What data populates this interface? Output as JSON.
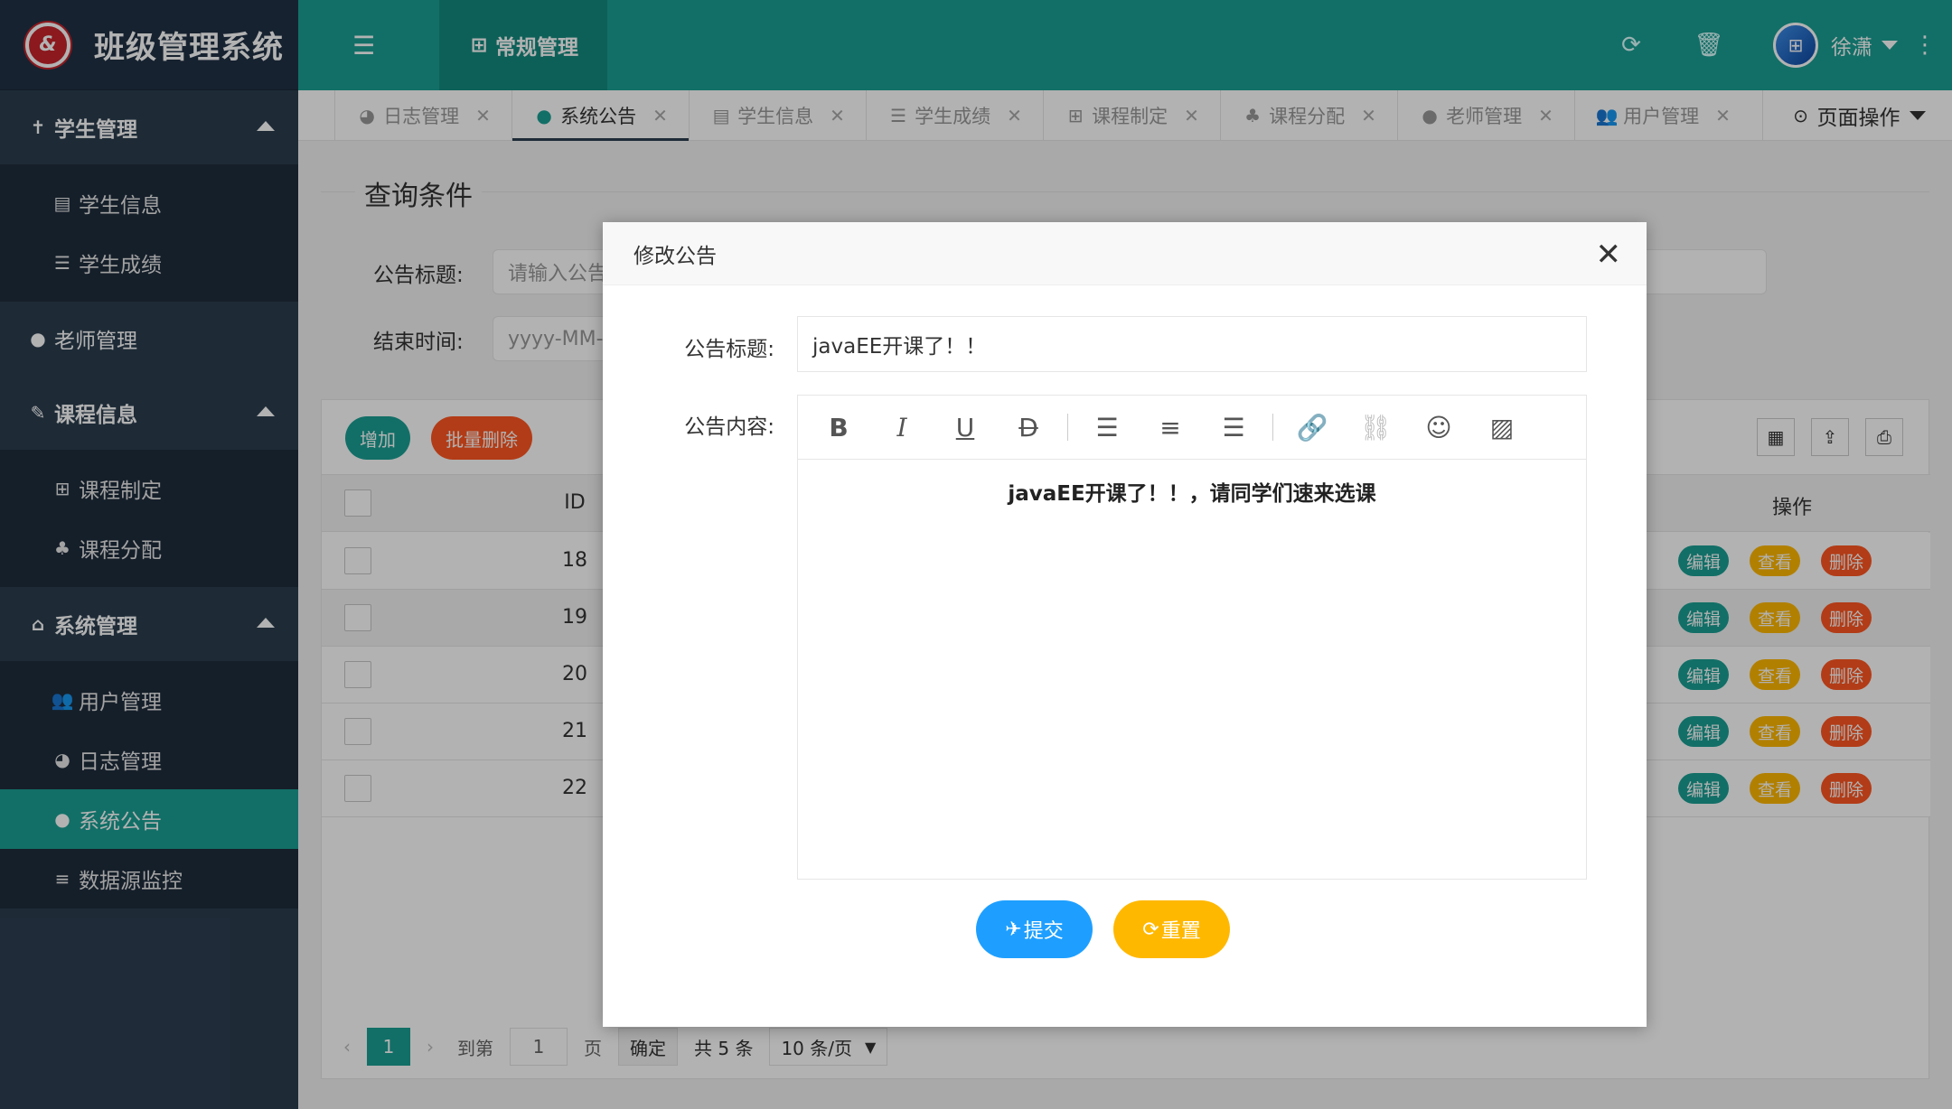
{
  "app": {
    "title": "班级管理系统",
    "logo_text": "&"
  },
  "sidebar": {
    "groups": [
      {
        "label": "学生管理",
        "icon": "person-standing-icon",
        "items": [
          {
            "label": "学生信息",
            "icon": "card-icon"
          },
          {
            "label": "学生成绩",
            "icon": "list-icon"
          }
        ]
      },
      {
        "label": "老师管理",
        "icon": "user-icon"
      },
      {
        "label": "课程信息",
        "icon": "edit-icon",
        "items": [
          {
            "label": "课程制定",
            "icon": "plus-square-icon"
          },
          {
            "label": "课程分配",
            "icon": "sitemap-icon"
          }
        ]
      },
      {
        "label": "系统管理",
        "icon": "home-icon",
        "items": [
          {
            "label": "用户管理",
            "icon": "users-icon"
          },
          {
            "label": "日志管理",
            "icon": "pie-chart-icon"
          },
          {
            "label": "系统公告",
            "icon": "comment-icon",
            "active": true
          },
          {
            "label": "数据源监控",
            "icon": "database-icon"
          }
        ]
      }
    ]
  },
  "topbar": {
    "module_tab": "常规管理",
    "user_name": "徐潇"
  },
  "tabs": [
    {
      "label": "日志管理"
    },
    {
      "label": "系统公告",
      "active": true
    },
    {
      "label": "学生信息"
    },
    {
      "label": "学生成绩"
    },
    {
      "label": "课程制定"
    },
    {
      "label": "课程分配"
    },
    {
      "label": "老师管理"
    },
    {
      "label": "用户管理"
    }
  ],
  "page_op": "页面操作",
  "query": {
    "title": "查询条件",
    "title_label": "公告标题:",
    "title_placeholder": "请输入公告",
    "end_label": "结束时间:",
    "end_placeholder": "yyyy-MM-d"
  },
  "table": {
    "add_label": "增加",
    "batch_delete_label": "批量删除",
    "col_id": "ID",
    "col_action": "操作",
    "rows": [
      {
        "id": "18"
      },
      {
        "id": "19"
      },
      {
        "id": "20"
      },
      {
        "id": "21"
      },
      {
        "id": "22"
      }
    ],
    "edit_label": "编辑",
    "view_label": "查看",
    "delete_label": "删除"
  },
  "pager": {
    "current": "1",
    "goto_label": "到第",
    "goto_value": "1",
    "page_label": "页",
    "confirm_label": "确定",
    "total_label": "共 5 条",
    "per_page": "10 条/页"
  },
  "modal": {
    "title": "修改公告",
    "title_label": "公告标题:",
    "title_value": "javaEE开课了！！",
    "content_label": "公告内容:",
    "content_value": "javaEE开课了！！，请同学们速来选课",
    "submit_label": "提交",
    "reset_label": "重置"
  },
  "colors": {
    "primary": "#1aa094",
    "sidebar": "#2c3e50",
    "warn": "#ffb800",
    "danger": "#ff5722",
    "blue": "#1e9fff"
  }
}
